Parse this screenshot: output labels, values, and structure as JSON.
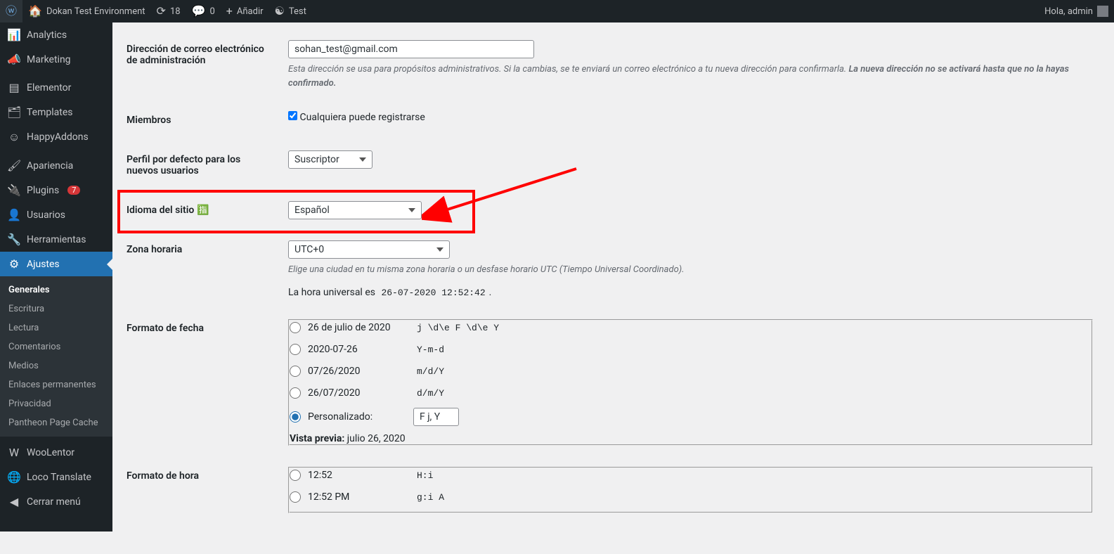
{
  "adminbar": {
    "site_name": "Dokan Test Environment",
    "updates": "18",
    "comments": "0",
    "new_label": "Añadir",
    "test_label": "Test",
    "greeting": "Hola, admin"
  },
  "sidebar": {
    "items": [
      {
        "icon": "📊",
        "label": "Analytics"
      },
      {
        "icon": "📣",
        "label": "Marketing"
      },
      {
        "icon": "▤",
        "label": "Elementor"
      },
      {
        "icon": "🗂",
        "label": "Templates"
      },
      {
        "icon": "☺",
        "label": "HappyAddons"
      },
      {
        "icon": "🖌",
        "label": "Apariencia"
      },
      {
        "icon": "🔌",
        "label": "Plugins",
        "badge": "7"
      },
      {
        "icon": "👤",
        "label": "Usuarios"
      },
      {
        "icon": "🔧",
        "label": "Herramientas"
      },
      {
        "icon": "⚙",
        "label": "Ajustes",
        "current": true
      }
    ],
    "submenu": [
      {
        "label": "Generales",
        "current": true
      },
      {
        "label": "Escritura"
      },
      {
        "label": "Lectura"
      },
      {
        "label": "Comentarios"
      },
      {
        "label": "Medios"
      },
      {
        "label": "Enlaces permanentes"
      },
      {
        "label": "Privacidad"
      },
      {
        "label": "Pantheon Page Cache"
      }
    ],
    "after": [
      {
        "icon": "W",
        "label": "WooLentor"
      },
      {
        "icon": "🌐",
        "label": "Loco Translate"
      },
      {
        "icon": "◀",
        "label": "Cerrar menú"
      }
    ]
  },
  "settings": {
    "admin_email": {
      "label": "Dirección de correo electrónico de administración",
      "value": "sohan_test@gmail.com",
      "desc_a": "Esta dirección se usa para propósitos administrativos. Si la cambias, se te enviará un correo electrónico a tu nueva dirección para confirmarla. ",
      "desc_b": "La nueva dirección no se activará hasta que no la hayas confirmado."
    },
    "membership": {
      "label": "Miembros",
      "checkbox": "Cualquiera puede registrarse"
    },
    "default_role": {
      "label": "Perfil por defecto para los nuevos usuarios",
      "value": "Suscriptor"
    },
    "site_lang": {
      "label": "Idioma del sitio",
      "value": "Español"
    },
    "timezone": {
      "label": "Zona horaria",
      "value": "UTC+0",
      "desc": "Elige una ciudad en tu misma zona horaria o un desfase horario UTC (Tiempo Universal Coordinado).",
      "utc_prefix": "La hora universal es ",
      "utc_value": "26-07-2020 12:52:42",
      "utc_suffix": "."
    },
    "date_format": {
      "label": "Formato de fecha",
      "options": [
        {
          "display": "26 de julio de 2020",
          "code": "j \\d\\e F \\d\\e Y"
        },
        {
          "display": "2020-07-26",
          "code": "Y-m-d"
        },
        {
          "display": "07/26/2020",
          "code": "m/d/Y"
        },
        {
          "display": "26/07/2020",
          "code": "d/m/Y"
        }
      ],
      "custom_label": "Personalizado:",
      "custom_value": "F j, Y",
      "preview_label": "Vista previa:",
      "preview_value": " julio 26, 2020"
    },
    "time_format": {
      "label": "Formato de hora",
      "options": [
        {
          "display": "12:52",
          "code": "H:i"
        },
        {
          "display": "12:52 PM",
          "code": "g:i A"
        }
      ]
    }
  }
}
